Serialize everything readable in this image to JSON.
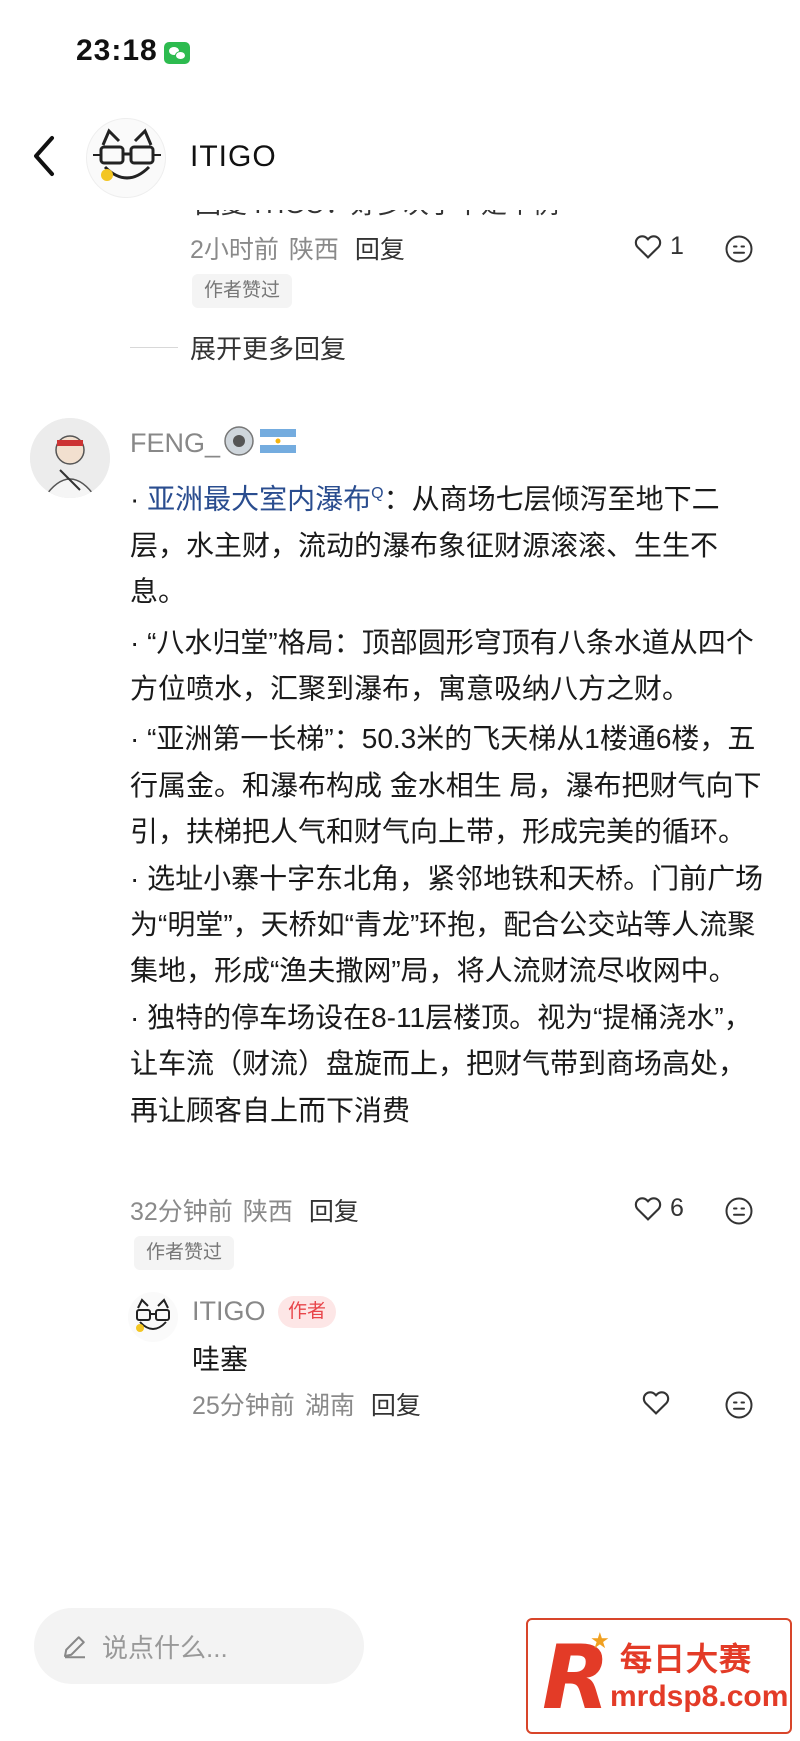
{
  "status_bar": {
    "time": "23:18"
  },
  "nav": {
    "title": "ITIGO"
  },
  "prev_reply": {
    "text": "回复 ITIGO：好多次了不是个例",
    "time": "2小时前",
    "location": "陕西",
    "reply_label": "回复",
    "likes": "1",
    "liked_tag": "作者赞过"
  },
  "expand_more": "展开更多回复",
  "comment": {
    "username": "FENG_",
    "paragraphs": [
      {
        "prefix": "· ",
        "highlight": "亚洲最大室内瀑布",
        "sup": "Q",
        "rest": "：从商场七层倾泻至地下二层，水主财，流动的瀑布象征财源滚滚、生生不息。"
      },
      {
        "prefix": "· ",
        "highlight": "",
        "sup": "",
        "rest": "“八水归堂”格局：顶部圆形穹顶有八条水道从四个方位喷水，汇聚到瀑布，寓意吸纳八方之财。"
      },
      {
        "prefix": "· ",
        "highlight": "",
        "sup": "",
        "rest": "“亚洲第一长梯”：50.3米的飞天梯从1楼通6楼，五行属金。和瀑布构成 金水相生 局，瀑布把财气向下引，扶梯把人气和财气向上带，形成完美的循环。"
      },
      {
        "prefix": "· ",
        "highlight": "",
        "sup": "",
        "rest": "选址小寨十字东北角，紧邻地铁和天桥。门前广场为“明堂”，天桥如“青龙”环抱，配合公交站等人流聚集地，形成“渔夫撒网”局，将人流财流尽收网中。"
      },
      {
        "prefix": "· ",
        "highlight": "",
        "sup": "",
        "rest": "独特的停车场设在8-11层楼顶。视为“提桶浇水”，让车流（财流）盘旋而上，把财气带到商场高处，再让顾客自上而下消费"
      }
    ],
    "time": "32分钟前",
    "location": "陕西",
    "reply_label": "回复",
    "likes": "6",
    "liked_tag": "作者赞过"
  },
  "author_reply": {
    "username": "ITIGO",
    "author_tag": "作者",
    "text": "哇塞",
    "time": "25分钟前",
    "location": "湖南",
    "reply_label": "回复"
  },
  "input": {
    "placeholder": "说点什么..."
  },
  "watermark": {
    "title": "每日大赛",
    "url": "mrdsp8.com"
  }
}
